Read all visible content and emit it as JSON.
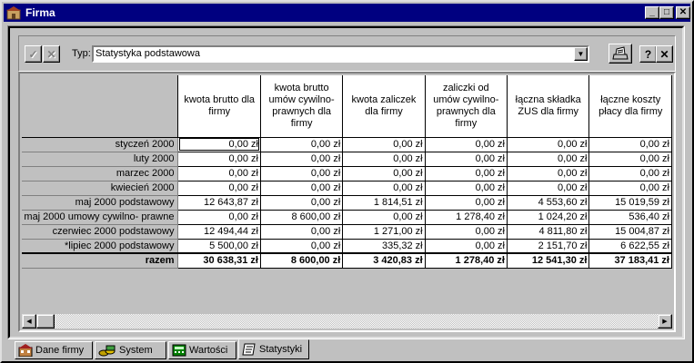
{
  "window": {
    "title": "Firma",
    "minimize_label": "_",
    "maximize_label": "□",
    "close_label": "✕"
  },
  "toolbar": {
    "confirm_label": "✓",
    "cancel_label": "✕",
    "typ_label": "Typ:",
    "typ_value": "Statystyka podstawowa",
    "help_label": "?",
    "close_label": "✕"
  },
  "table": {
    "columns": [
      "kwota brutto dla firmy",
      "kwota brutto umów cywilno-prawnych dla firmy",
      "kwota zaliczek dla firmy",
      "zaliczki od umów cywilno-prawnych dla firmy",
      "łączna składka ZUS dla firmy",
      "łączne koszty płacy dla firmy"
    ],
    "rows": [
      {
        "label": "styczeń 2000",
        "cells": [
          "0,00 zł",
          "0,00 zł",
          "0,00 zł",
          "0,00 zł",
          "0,00 zł",
          "0,00 zł"
        ]
      },
      {
        "label": "luty 2000",
        "cells": [
          "0,00 zł",
          "0,00 zł",
          "0,00 zł",
          "0,00 zł",
          "0,00 zł",
          "0,00 zł"
        ]
      },
      {
        "label": "marzec 2000",
        "cells": [
          "0,00 zł",
          "0,00 zł",
          "0,00 zł",
          "0,00 zł",
          "0,00 zł",
          "0,00 zł"
        ]
      },
      {
        "label": "kwiecień 2000",
        "cells": [
          "0,00 zł",
          "0,00 zł",
          "0,00 zł",
          "0,00 zł",
          "0,00 zł",
          "0,00 zł"
        ]
      },
      {
        "label": "maj 2000 podstawowy",
        "cells": [
          "12 643,87 zł",
          "0,00 zł",
          "1 814,51 zł",
          "0,00 zł",
          "4 553,60 zł",
          "15 019,59 zł"
        ]
      },
      {
        "label": "maj 2000 umowy cywilno- prawne",
        "cells": [
          "0,00 zł",
          "8 600,00 zł",
          "0,00 zł",
          "1 278,40 zł",
          "1 024,20 zł",
          "536,40 zł"
        ]
      },
      {
        "label": "czerwiec 2000 podstawowy",
        "cells": [
          "12 494,44 zł",
          "0,00 zł",
          "1 271,00 zł",
          "0,00 zł",
          "4 811,80 zł",
          "15 004,87 zł"
        ]
      },
      {
        "label": "*lipiec 2000 podstawowy",
        "cells": [
          "5 500,00 zł",
          "0,00 zł",
          "335,32 zł",
          "0,00 zł",
          "2 151,70 zł",
          "6 622,55 zł"
        ]
      }
    ],
    "total": {
      "label": "razem",
      "cells": [
        "30 638,31 zł",
        "8 600,00 zł",
        "3 420,83 zł",
        "1 278,40 zł",
        "12 541,30 zł",
        "37 183,41 zł"
      ]
    }
  },
  "tabs": [
    {
      "label": "Dane firmy",
      "icon": "building-icon"
    },
    {
      "label": "System",
      "icon": "coins-icon"
    },
    {
      "label": "Wartości",
      "icon": "calculator-icon"
    },
    {
      "label": "Statystyki",
      "icon": "notebook-icon",
      "active": true
    }
  ]
}
